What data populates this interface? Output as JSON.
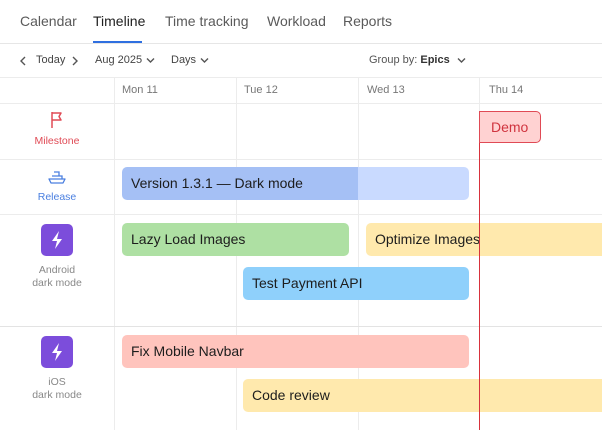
{
  "tabs": [
    {
      "label": "Calendar"
    },
    {
      "label": "Timeline"
    },
    {
      "label": "Time tracking"
    },
    {
      "label": "Workload"
    },
    {
      "label": "Reports"
    }
  ],
  "toolbar": {
    "today_label": "Today",
    "month_label": "Aug 2025",
    "scale_label": "Days",
    "group_by_label": "Group by:",
    "group_by_value": "Epics"
  },
  "days": [
    "Mon 11",
    "Tue 12",
    "Wed 13",
    "Thu 14"
  ],
  "groups": {
    "milestone": "Milestone",
    "release": "Release",
    "android": "Android\ndark mode",
    "ios": "iOS\ndark mode"
  },
  "bars": {
    "version": "Version 1.3.1 — Dark mode",
    "lazy_load": "Lazy Load Images",
    "optimize": "Optimize Images",
    "test_payment": "Test Payment API",
    "fix_navbar": "Fix Mobile Navbar",
    "code_review": "Code review"
  },
  "milestone_label": "Demo",
  "colors": {
    "accent": "#2f6fe0",
    "today_line": "#d8323c",
    "milestone_icon": "#e04a55",
    "release_icon": "#4a7fe0",
    "epic_icon": "#7c4ddb",
    "version_progress": "#a5c0f5",
    "version_rest": "#c9daff",
    "green": "#aee0a3",
    "yellow": "#ffe9ad",
    "blue": "#8fd0fb",
    "red": "#ffc4bd"
  }
}
